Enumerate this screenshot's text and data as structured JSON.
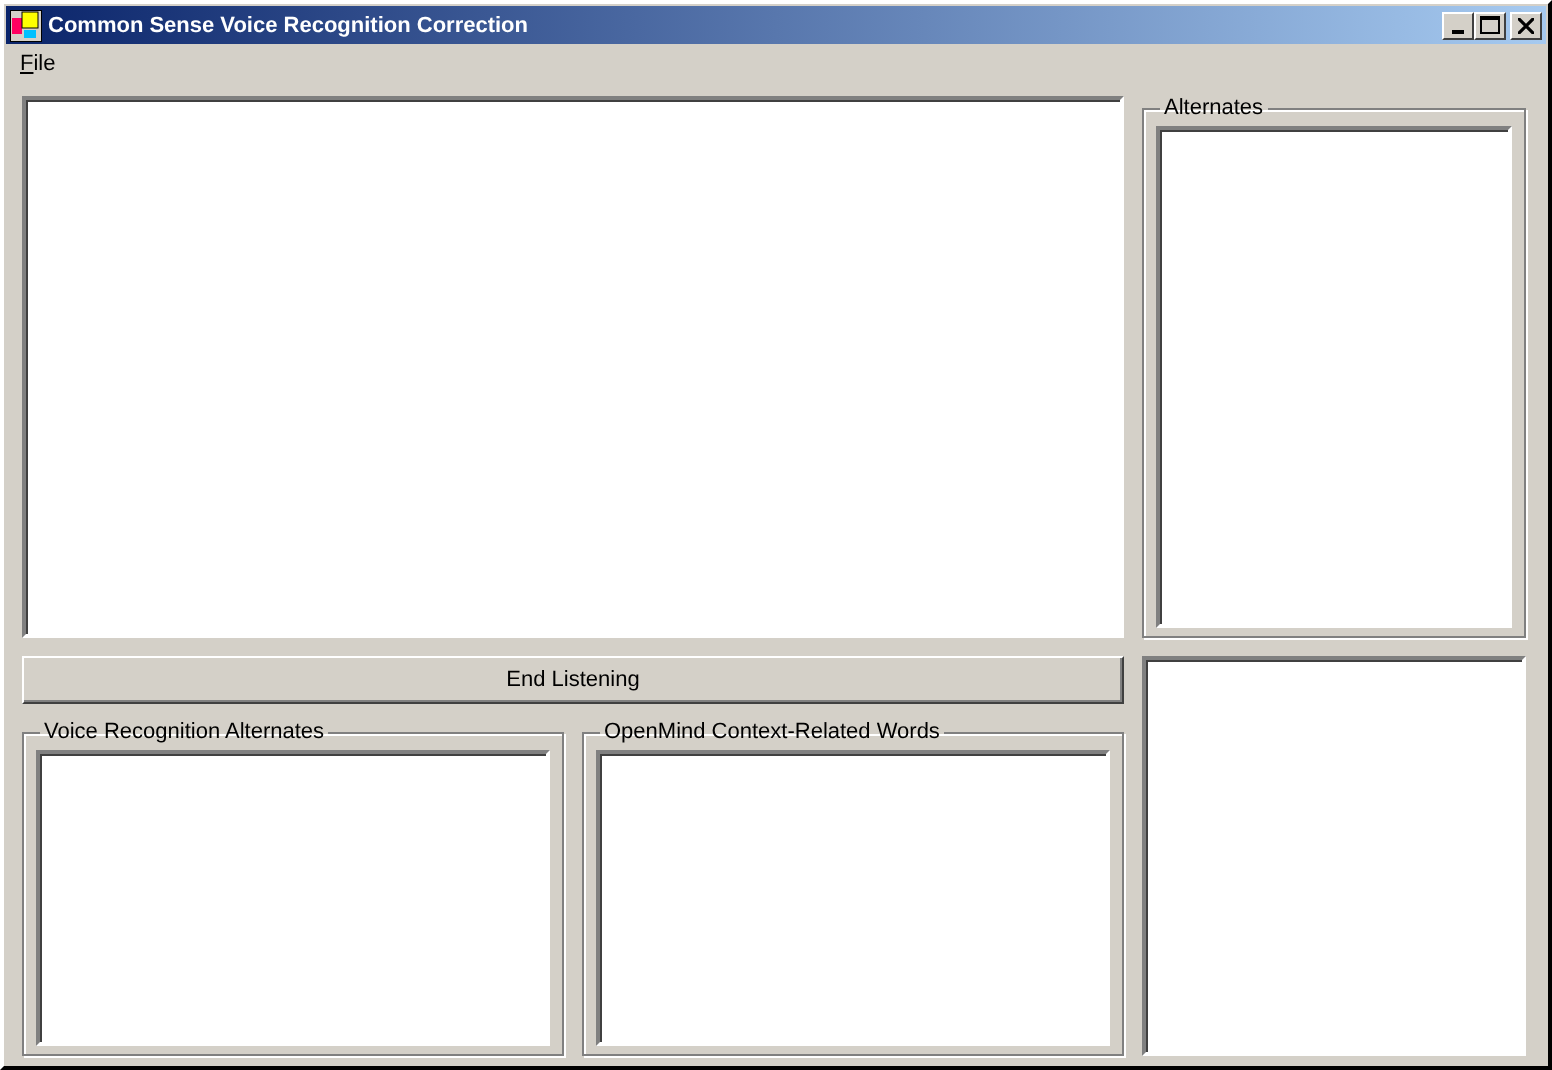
{
  "window": {
    "title": "Common Sense Voice Recognition Correction"
  },
  "menu": [
    {
      "label": "File"
    }
  ],
  "alternates_group": {
    "title": "Alternates"
  },
  "end_button": {
    "label": "End Listening"
  },
  "voice_alternates_group": {
    "title": "Voice Recognition Alternates"
  },
  "context_words_group": {
    "title": "OpenMind Context-Related Words"
  }
}
